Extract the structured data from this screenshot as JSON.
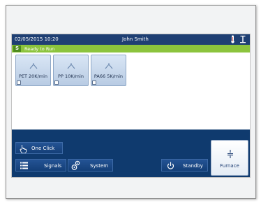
{
  "titlebar": {
    "datetime": "02/05/2015 10:20",
    "user": "John Smith",
    "icons": [
      "thermometer-icon",
      "balance-icon"
    ]
  },
  "status": {
    "badge": "S",
    "text": "Ready to Run",
    "color": "#8cc43d"
  },
  "methods": [
    {
      "label": "PET 20K/min",
      "icon": "lamp-icon"
    },
    {
      "label": "PP 10K/min",
      "icon": "lamp-icon"
    },
    {
      "label": "PA66 5K/min",
      "icon": "lamp-icon"
    }
  ],
  "toolbar": {
    "one_click": "One Click",
    "signals": "Signals",
    "system": "System",
    "standby": "Standby",
    "furnace": "Furnace"
  },
  "colors": {
    "titlebar": "#1f3f73",
    "bottom_panel": "#0f3a6e",
    "accent_green": "#8cc43d"
  }
}
